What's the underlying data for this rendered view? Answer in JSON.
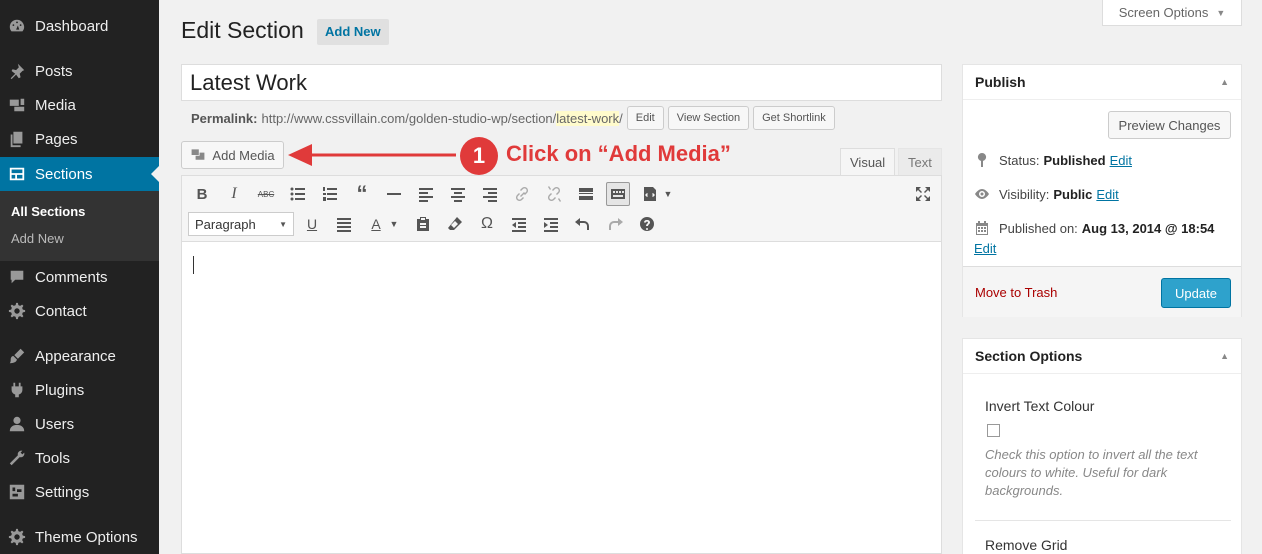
{
  "sidebar": {
    "items": [
      {
        "label": "Dashboard",
        "icon": "dashboard-icon"
      },
      {
        "label": "Posts",
        "icon": "pushpin-icon"
      },
      {
        "label": "Media",
        "icon": "media-icon"
      },
      {
        "label": "Pages",
        "icon": "pages-icon"
      },
      {
        "label": "Sections",
        "icon": "sections-icon"
      },
      {
        "label": "Comments",
        "icon": "comments-icon"
      },
      {
        "label": "Contact",
        "icon": "contact-gear-icon"
      },
      {
        "label": "Appearance",
        "icon": "appearance-icon"
      },
      {
        "label": "Plugins",
        "icon": "plugins-icon"
      },
      {
        "label": "Users",
        "icon": "users-icon"
      },
      {
        "label": "Tools",
        "icon": "tools-icon"
      },
      {
        "label": "Settings",
        "icon": "settings-icon"
      },
      {
        "label": "Theme Options",
        "icon": "theme-options-icon"
      }
    ],
    "submenu": [
      {
        "label": "All Sections"
      },
      {
        "label": "Add New"
      }
    ]
  },
  "header": {
    "title": "Edit Section",
    "add_new": "Add New",
    "screen_options": "Screen Options"
  },
  "post": {
    "title": "Latest Work",
    "permalink_label": "Permalink:",
    "permalink_base": "http://www.cssvillain.com/golden-studio-wp/section/",
    "permalink_slug": "latest-work",
    "permalink_tail": "/",
    "edit_btn": "Edit",
    "view_btn": "View Section",
    "shortlink_btn": "Get Shortlink"
  },
  "editor": {
    "add_media": "Add Media",
    "annotation_step": "1",
    "annotation_text": "Click on “Add Media”",
    "tab_visual": "Visual",
    "tab_text": "Text",
    "format_value": "Paragraph"
  },
  "publish": {
    "title": "Publish",
    "preview": "Preview Changes",
    "status_label": "Status:",
    "status_value": "Published",
    "visibility_label": "Visibility:",
    "visibility_value": "Public",
    "published_label": "Published on:",
    "published_value": "Aug 13, 2014 @ 18:54",
    "edit_link": "Edit",
    "trash": "Move to Trash",
    "update": "Update"
  },
  "section_options": {
    "title": "Section Options",
    "invert_label": "Invert Text Colour",
    "invert_help": "Check this option to invert all the text colours to white. Useful for dark backgrounds.",
    "remove_grid_label": "Remove Grid"
  },
  "colors": {
    "accent": "#0074a2",
    "annotation": "#e03a3a",
    "update_button": "#2ea2cc"
  }
}
